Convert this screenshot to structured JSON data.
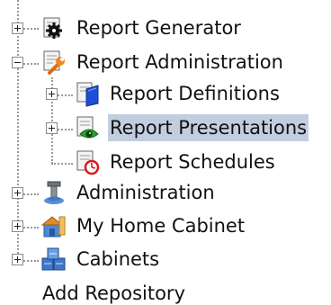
{
  "tree": {
    "nodes": [
      {
        "label": "Report Generator",
        "icon": "gear-document-icon",
        "toggle": "plus"
      },
      {
        "label": "Report Administration",
        "icon": "wrench-document-icon",
        "toggle": "minus"
      },
      {
        "label": "Report Definitions",
        "icon": "book-document-icon",
        "toggle": "plus"
      },
      {
        "label": "Report Presentations",
        "icon": "eye-document-icon",
        "toggle": "plus",
        "selected": true
      },
      {
        "label": "Report Schedules",
        "icon": "clock-document-icon",
        "toggle": "none"
      },
      {
        "label": "Administration",
        "icon": "admin-tool-icon",
        "toggle": "plus"
      },
      {
        "label": "My Home Cabinet",
        "icon": "home-cabinet-icon",
        "toggle": "plus"
      },
      {
        "label": "Cabinets",
        "icon": "cabinets-icon",
        "toggle": "plus"
      }
    ],
    "add_repository": "Add Repository"
  },
  "colors": {
    "selection": "#c3cde0",
    "connector": "#9a9a9a",
    "text": "#111111"
  }
}
